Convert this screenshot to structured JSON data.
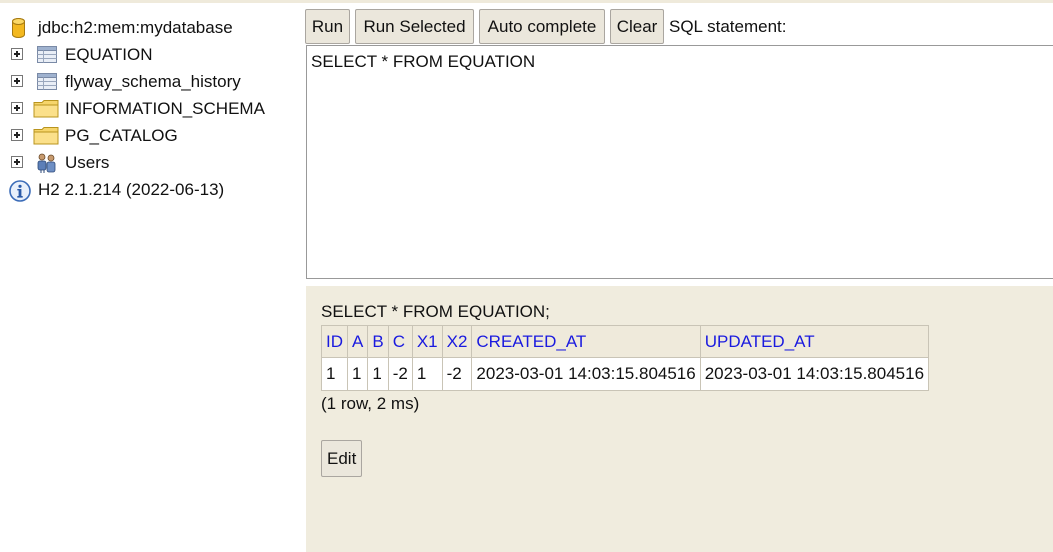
{
  "tree": {
    "connection": "jdbc:h2:mem:mydatabase",
    "items": [
      {
        "label": "EQUATION",
        "icon": "table-icon"
      },
      {
        "label": "flyway_schema_history",
        "icon": "table-icon"
      },
      {
        "label": "INFORMATION_SCHEMA",
        "icon": "folder-icon"
      },
      {
        "label": "PG_CATALOG",
        "icon": "folder-icon"
      },
      {
        "label": "Users",
        "icon": "users-icon"
      }
    ],
    "version": "H2 2.1.214 (2022-06-13)"
  },
  "toolbar": {
    "run": "Run",
    "run_selected": "Run Selected",
    "auto_complete": "Auto complete",
    "clear": "Clear",
    "sql_label": "SQL statement:"
  },
  "editor": {
    "value": "SELECT * FROM EQUATION"
  },
  "result": {
    "query": "SELECT * FROM EQUATION;",
    "columns": [
      "ID",
      "A",
      "B",
      "C",
      "X1",
      "X2",
      "CREATED_AT",
      "UPDATED_AT"
    ],
    "rows": [
      [
        "1",
        "1",
        "1",
        "-2",
        "1",
        "-2",
        "2023-03-01 14:03:15.804516",
        "2023-03-01 14:03:15.804516"
      ]
    ],
    "row_info": "(1 row, 2 ms)",
    "edit": "Edit"
  },
  "colors": {
    "pane_background": "#f0ecde",
    "header_text": "#1a1adf",
    "button_background": "#ebe7dc"
  }
}
